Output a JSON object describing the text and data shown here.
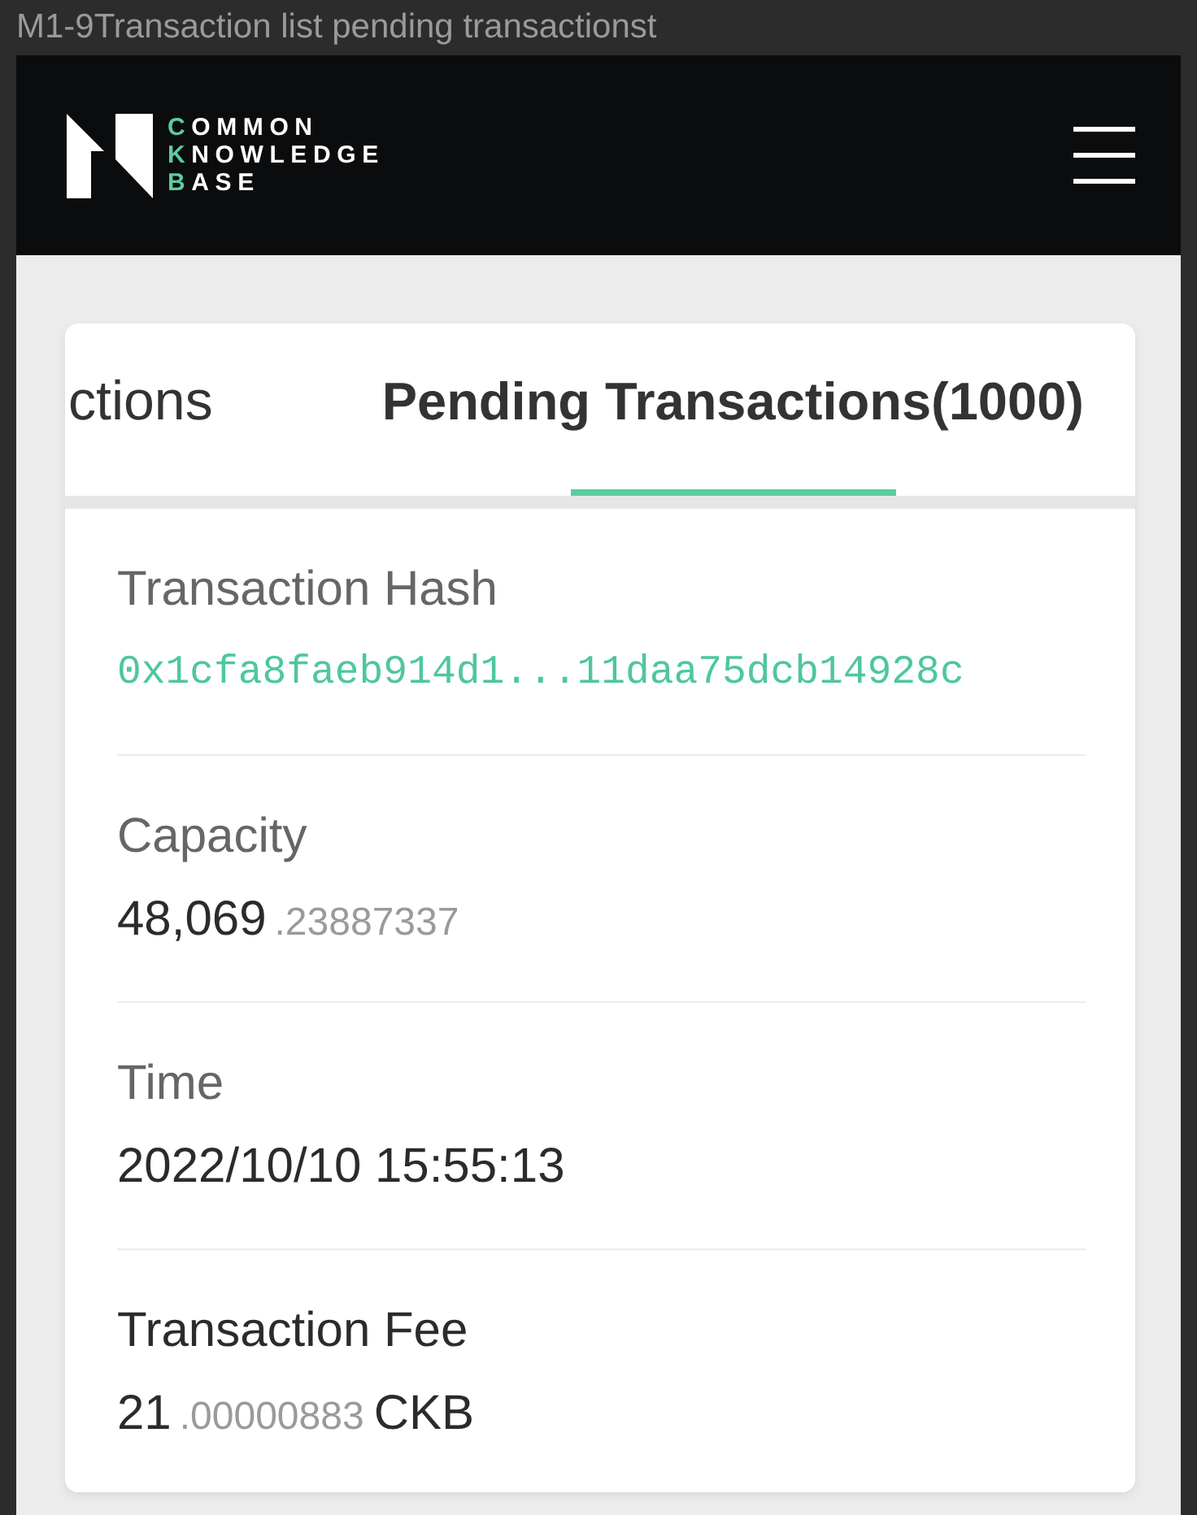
{
  "frame": {
    "title": "M1-9Transaction list pending transactionst"
  },
  "header": {
    "logo": {
      "lines": [
        "COMMON",
        "KNOWLEDGE",
        "BASE"
      ]
    }
  },
  "tabs": [
    {
      "label": "ctions",
      "selected": false
    },
    {
      "label": "Pending Transactions(1000)",
      "selected": true
    }
  ],
  "transaction": {
    "fields": [
      {
        "kind": "hash",
        "label": "Transaction Hash",
        "emphasized": false,
        "value": "0x1cfa8faeb914d1...11daa75dcb14928c"
      },
      {
        "kind": "amount",
        "label": "Capacity",
        "emphasized": false,
        "integer": "48,069",
        "decimal": ".23887337"
      },
      {
        "kind": "text",
        "label": "Time",
        "emphasized": false,
        "value": "2022/10/10 15:55:13"
      },
      {
        "kind": "amount",
        "label": "Transaction Fee",
        "emphasized": true,
        "integer": "21",
        "decimal": ".00000883",
        "unit": "CKB"
      }
    ]
  }
}
